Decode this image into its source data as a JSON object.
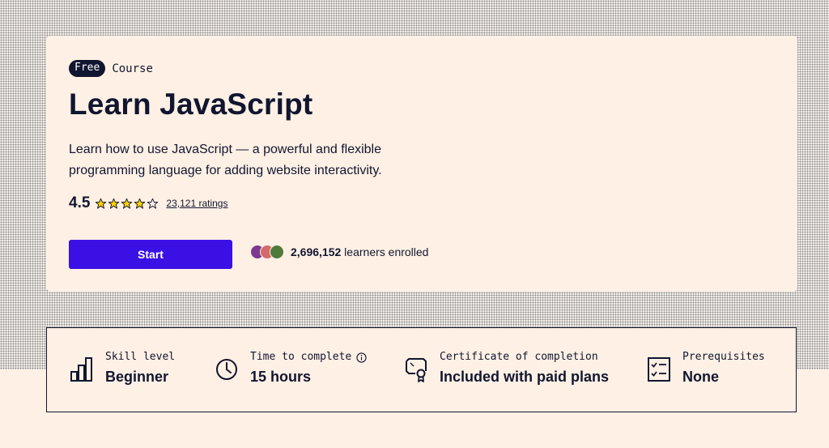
{
  "hero": {
    "badge": "Free",
    "type_label": "Course",
    "title": "Learn JavaScript",
    "description": "Learn how to use JavaScript — a powerful and flexible programming language for adding website interactivity.",
    "rating_value": "4.5",
    "rating_stars": 4.5,
    "ratings_link": "23,121 ratings",
    "start_label": "Start",
    "learners_count": "2,696,152",
    "learners_suffix": " learners enrolled"
  },
  "stats": [
    {
      "label": "Skill level",
      "value": "Beginner",
      "icon": "bar-chart-icon"
    },
    {
      "label": "Time to complete",
      "value": "15 hours",
      "icon": "clock-icon"
    },
    {
      "label": "Certificate of completion",
      "value": "Included with paid plans",
      "icon": "certificate-icon"
    },
    {
      "label": "Prerequisites",
      "value": "None",
      "icon": "checklist-icon"
    }
  ],
  "colors": {
    "accent": "#3a10e5",
    "text": "#10162f",
    "background": "#fff0e5",
    "star": "#ffd300"
  }
}
